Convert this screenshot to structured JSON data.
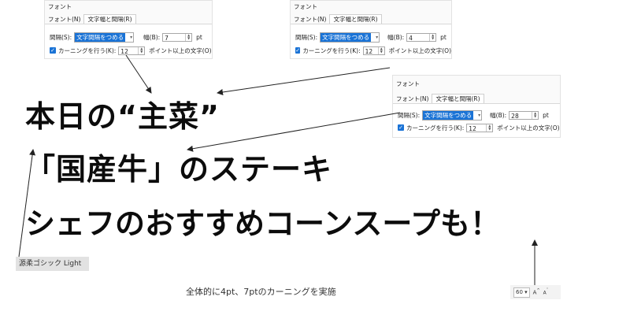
{
  "dialog": {
    "title": "フォント",
    "tab_font": "フォント(N)",
    "tab_spacing": "文字幅と間隔(R)",
    "spacing_label": "間隔(S):",
    "spacing_value": "文字間隔をつめる",
    "width_label": "幅(B):",
    "unit": "pt",
    "kerning_label": "カーニングを行う(K):",
    "kerning_value": "12",
    "kerning_suffix": "ポイント以上の文字(O)"
  },
  "dialogs": [
    {
      "width_value": "7"
    },
    {
      "width_value": "4"
    },
    {
      "width_value": "28"
    }
  ],
  "main": {
    "line1": "本日の“主菜”",
    "line2": "「国産牛」のステーキ",
    "line3": "シェフのおすすめコーンスープも！"
  },
  "font_name_box": "源柔ゴシック Light",
  "caption": "全体的に4pt、7ptのカーニングを実施",
  "zoom_control": {
    "value": "60",
    "grow_label": "A",
    "shrink_label": "A"
  }
}
